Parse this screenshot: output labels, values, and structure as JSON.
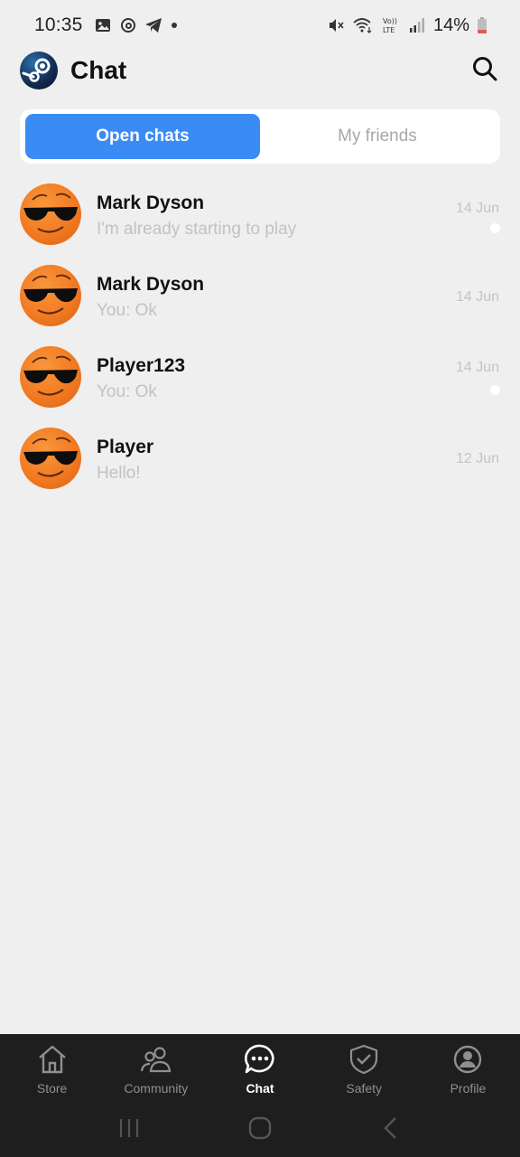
{
  "status_bar": {
    "time": "10:35",
    "battery": "14%",
    "left_icons": [
      "gallery-icon",
      "threads-icon",
      "telegram-icon",
      "dot-icon"
    ],
    "right_icons": [
      "mute-icon",
      "wifi-icon",
      "volte-icon",
      "signal-icon",
      "battery-icon"
    ]
  },
  "header": {
    "title": "Chat",
    "logo_icon": "steam-logo-icon",
    "search_icon": "search-icon"
  },
  "tabs": [
    {
      "label": "Open chats",
      "active": true
    },
    {
      "label": "My friends",
      "active": false
    }
  ],
  "chats": [
    {
      "name": "Mark Dyson",
      "preview": "I'm already starting to play",
      "date": "14 Jun",
      "unread": true
    },
    {
      "name": "Mark Dyson",
      "preview": "You: Ok",
      "date": "14 Jun",
      "unread": false
    },
    {
      "name": "Player123",
      "preview": "You: Ok",
      "date": "14 Jun",
      "unread": true
    },
    {
      "name": "Player",
      "preview": "Hello!",
      "date": "12 Jun",
      "unread": false
    }
  ],
  "bottom_nav": [
    {
      "label": "Store",
      "icon": "home-icon",
      "active": false
    },
    {
      "label": "Community",
      "icon": "people-icon",
      "active": false
    },
    {
      "label": "Chat",
      "icon": "chat-bubble-icon",
      "active": true
    },
    {
      "label": "Safety",
      "icon": "shield-check-icon",
      "active": false
    },
    {
      "label": "Profile",
      "icon": "user-circle-icon",
      "active": false
    }
  ],
  "colors": {
    "accent": "#3b8bf4",
    "background": "#efefef",
    "nav_background": "#1e1e1e",
    "avatar": "#f27a22"
  }
}
